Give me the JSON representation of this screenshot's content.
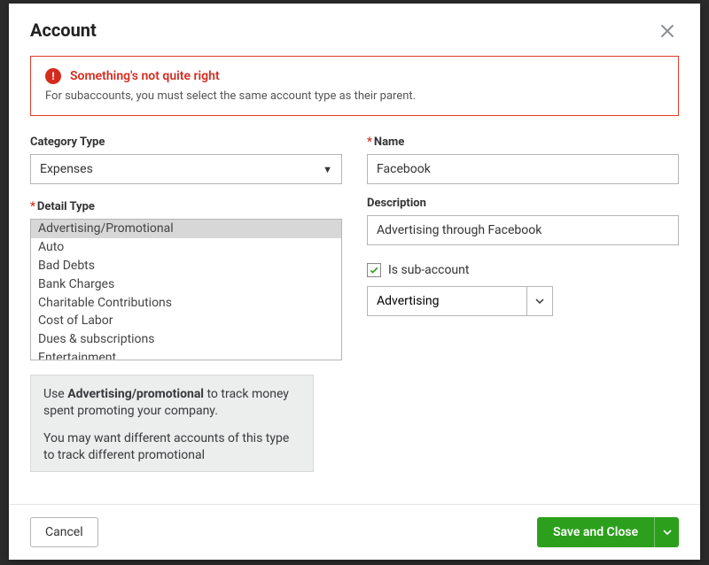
{
  "modal": {
    "title": "Account"
  },
  "alert": {
    "title": "Something's not quite right",
    "body": "For subaccounts, you must select the same account type as their parent."
  },
  "fields": {
    "categoryType": {
      "label": "Category Type",
      "value": "Expenses"
    },
    "detailType": {
      "label": "Detail Type",
      "selected": "Advertising/Promotional",
      "options": [
        "Advertising/Promotional",
        "Auto",
        "Bad Debts",
        "Bank Charges",
        "Charitable Contributions",
        "Cost of Labor",
        "Dues & subscriptions",
        "Entertainment"
      ]
    },
    "name": {
      "label": "Name",
      "value": "Facebook"
    },
    "description": {
      "label": "Description",
      "value": "Advertising through Facebook"
    },
    "isSub": {
      "label": "Is sub-account",
      "checked": true
    },
    "parent": {
      "value": "Advertising"
    }
  },
  "help": {
    "line1_pre": "Use ",
    "line1_bold": "Advertising/promotional",
    "line1_post": " to track money spent promoting your company.",
    "line2": "You may want different accounts of this type to track different promotional"
  },
  "footer": {
    "cancel": "Cancel",
    "save": "Save and Close"
  }
}
